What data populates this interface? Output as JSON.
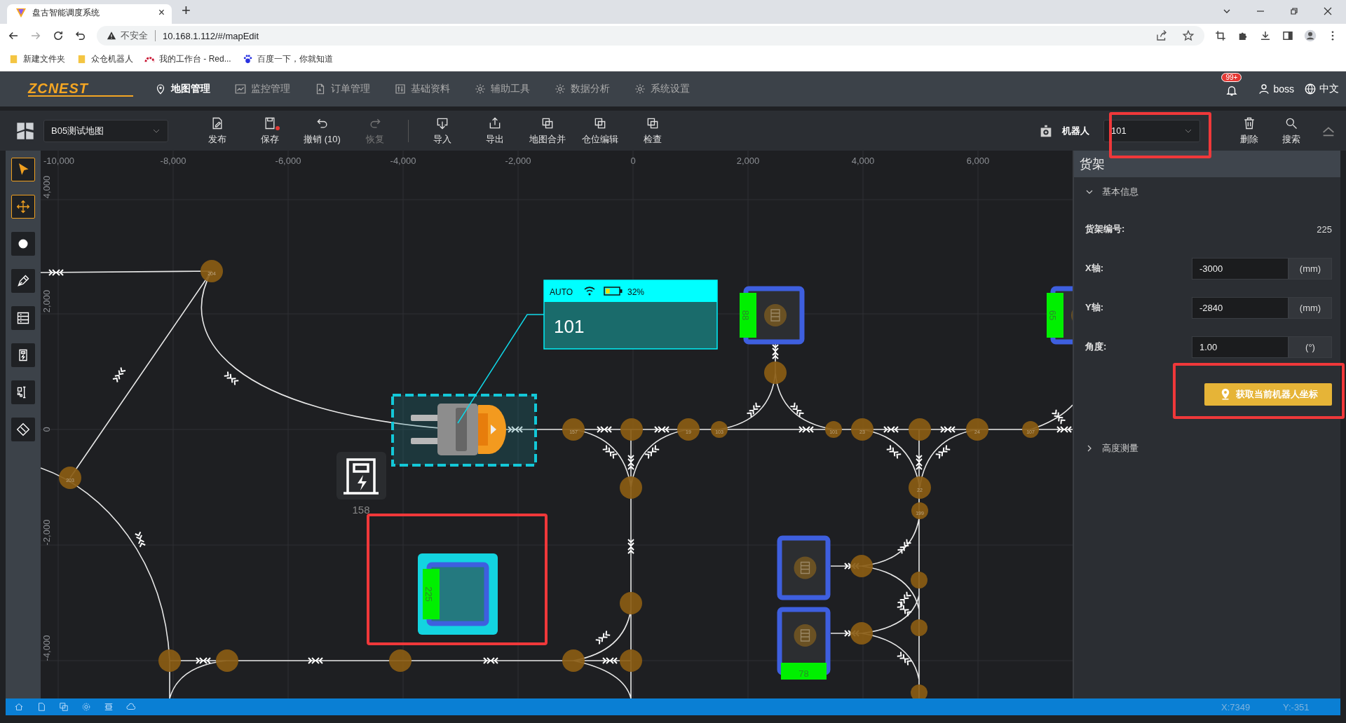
{
  "browser": {
    "tab_title": "盘古智能调度系统",
    "tab_close": "×",
    "new_tab": "+",
    "security": "不安全",
    "url": "10.168.1.112/#/mapEdit",
    "bookmarks": [
      {
        "kind": "folder",
        "label": "新建文件夹"
      },
      {
        "kind": "folder",
        "label": "众仓机器人"
      },
      {
        "kind": "arc",
        "label": "我的工作台 - Red..."
      },
      {
        "kind": "paw",
        "label": "百度一下，你就知道"
      }
    ]
  },
  "nav": {
    "logo": "ZCNEST",
    "items": [
      {
        "kind": "pin",
        "label": "地图管理",
        "selected": true
      },
      {
        "kind": "chart",
        "label": "监控管理",
        "selected": false
      },
      {
        "kind": "doc",
        "label": "订单管理",
        "selected": false
      },
      {
        "kind": "sliders",
        "label": "基础资料",
        "selected": false
      },
      {
        "kind": "gear",
        "label": "辅助工具",
        "selected": false
      },
      {
        "kind": "gear",
        "label": "数据分析",
        "selected": false
      },
      {
        "kind": "gear",
        "label": "系统设置",
        "selected": false
      }
    ],
    "badge": "99+",
    "user": "boss",
    "language": "中文"
  },
  "toolbar": {
    "map": "B05测试地图",
    "actions": [
      {
        "kind": "edit",
        "label": "发布",
        "disabled": false,
        "unsaved": false
      },
      {
        "kind": "save",
        "label": "保存",
        "disabled": false,
        "unsaved": true
      },
      {
        "kind": "undo",
        "label": "撤销 (10)",
        "disabled": false,
        "unsaved": false
      },
      {
        "kind": "redo",
        "label": "恢复",
        "disabled": true,
        "unsaved": false
      },
      {
        "kind": "import",
        "label": "导入",
        "disabled": false,
        "unsaved": false
      },
      {
        "kind": "export",
        "label": "导出",
        "disabled": false,
        "unsaved": false
      },
      {
        "kind": "copy",
        "label": "地图合并",
        "disabled": false,
        "unsaved": false
      },
      {
        "kind": "copy",
        "label": "仓位编辑",
        "disabled": false,
        "unsaved": false
      },
      {
        "kind": "copy",
        "label": "检查",
        "disabled": false,
        "unsaved": false
      }
    ],
    "robot_label": "机器人",
    "robot": "101",
    "tools": [
      {
        "kind": "trash",
        "label": "删除"
      },
      {
        "kind": "search",
        "label": "搜索"
      }
    ]
  },
  "tools": [
    {
      "kind": "pointer",
      "selected": true
    },
    {
      "kind": "move",
      "selected": true
    },
    {
      "kind": "dot",
      "selected": false
    },
    {
      "kind": "pen",
      "selected": false
    },
    {
      "kind": "shelf",
      "selected": false
    },
    {
      "kind": "charger",
      "selected": false
    },
    {
      "kind": "qr",
      "selected": false
    },
    {
      "kind": "tag",
      "selected": false
    }
  ],
  "map": {
    "x_ticks": [
      "-10,000",
      "-8,000",
      "-6,000",
      "-4,000",
      "-2,000",
      "0",
      "2,000",
      "4,000",
      "6,000"
    ],
    "y_ticks": [
      "4,000",
      "2,000",
      "0",
      "-2,000",
      "-4,000"
    ],
    "node_labels": [
      "157",
      "19",
      "103",
      "101",
      "23",
      "24",
      "107",
      "22",
      "199",
      "204",
      "203"
    ],
    "shelves": [
      {
        "number": "88",
        "selected": false
      },
      {
        "number": "65",
        "selected": false
      },
      {
        "number": "225",
        "selected": true
      },
      {
        "selected": false
      },
      {
        "number": "78",
        "selected": false
      }
    ],
    "robot": {
      "mode": "AUTO",
      "level": 0.32,
      "battery": "32%",
      "name": "101"
    },
    "charger": "158"
  },
  "panel": {
    "title": "货架",
    "sections": [
      {
        "title": "基本信息",
        "expanded": true,
        "fields": [
          {
            "kind": "text",
            "label": "货架编号:",
            "value": "225"
          },
          {
            "kind": "input",
            "label": "X轴:",
            "value": "-3000",
            "unit": "(mm)"
          },
          {
            "kind": "input",
            "label": "Y轴:",
            "value": "-2840",
            "unit": "(mm)"
          },
          {
            "kind": "input",
            "label": "角度:",
            "value": "1.00",
            "unit": "(°)"
          }
        ],
        "action": "获取当前机器人坐标"
      },
      {
        "title": "高度测量",
        "expanded": false
      }
    ]
  },
  "status": {
    "x": "X:7349",
    "y": "Y:-351"
  }
}
